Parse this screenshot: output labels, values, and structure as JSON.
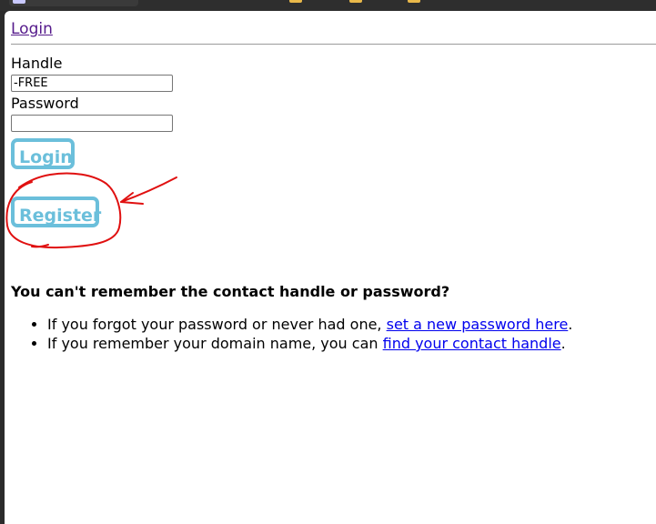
{
  "page": {
    "nav": {
      "login_link": "Login"
    },
    "form": {
      "handle_label": "Handle",
      "handle_value": "-FREE",
      "password_label": "Password",
      "password_value": "",
      "login_button": "Login",
      "register_button": "Register"
    },
    "help": {
      "heading": "You can't remember the contact handle or password?",
      "items": [
        {
          "prefix": "If you forgot your password or never had one, ",
          "link": "set a new password here",
          "suffix": "."
        },
        {
          "prefix": "If you remember your domain name, you can ",
          "link": "find your contact handle",
          "suffix": "."
        }
      ]
    }
  },
  "colors": {
    "button_accent": "#6bbfdb",
    "annotation_red": "#e01010",
    "visited_link": "#551a8b",
    "link": "#0000ee"
  },
  "icons": [
    "red-circle-annotation",
    "red-arrow-annotation"
  ]
}
